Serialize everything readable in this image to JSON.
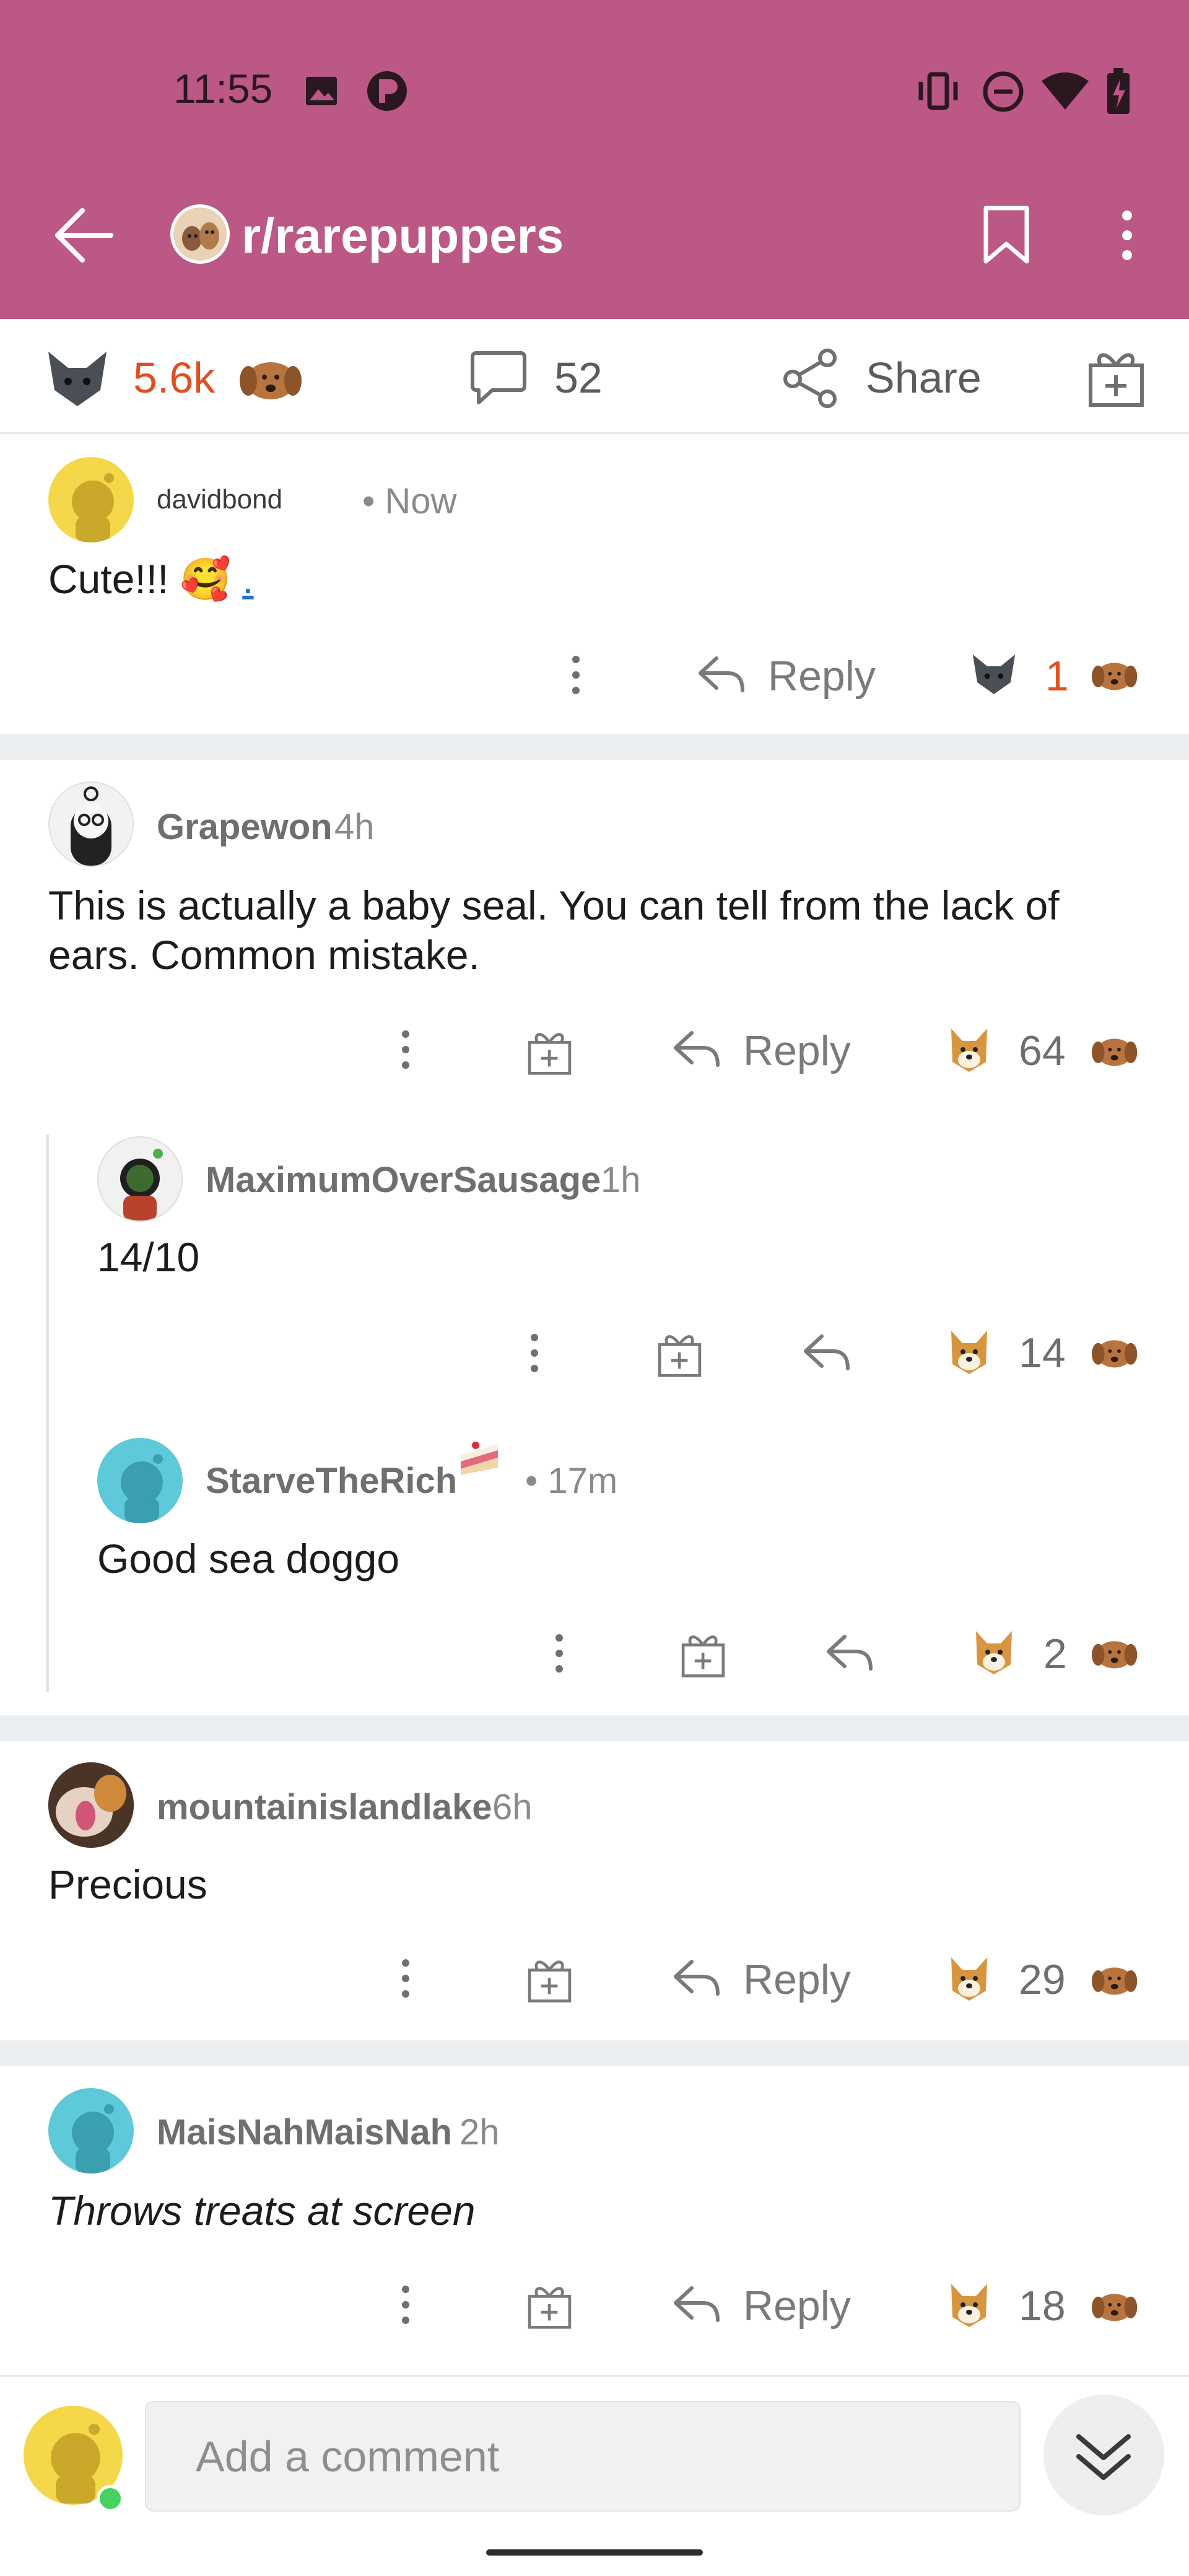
{
  "status_bar": {
    "time": "11:55"
  },
  "header": {
    "subreddit": "r/rarepuppers"
  },
  "post_bar": {
    "votes": "5.6k",
    "comments": "52",
    "share_label": "Share"
  },
  "colors": {
    "header_bg": "#bb5886",
    "upvote_accent": "#e0501f",
    "divider": "#eceff1"
  },
  "comments": [
    {
      "author": "davidbond",
      "time": "• Now",
      "text": "Cute!!! 🥰 ",
      "link_text": ".",
      "reply_label": "Reply",
      "votes": "1"
    },
    {
      "author": "Grapewon",
      "time": "4h",
      "text": "This is actually a baby seal. You can tell from the lack of ears. Common mistake.",
      "reply_label": "Reply",
      "votes": "64"
    },
    {
      "author": "MaximumOverSausage",
      "time": "1h",
      "text": "14/10",
      "votes": "14"
    },
    {
      "author": "StarveTheRich",
      "time": "• 17m",
      "text": "Good sea doggo",
      "votes": "2"
    },
    {
      "author": "mountainislandlake",
      "time": "6h",
      "text": "Precious",
      "reply_label": "Reply",
      "votes": "29"
    },
    {
      "author": "MaisNahMaisNah",
      "time": "2h",
      "text": "Throws treats at screen",
      "reply_label": "Reply",
      "votes": "18"
    }
  ],
  "composer": {
    "placeholder": "Add a comment"
  }
}
